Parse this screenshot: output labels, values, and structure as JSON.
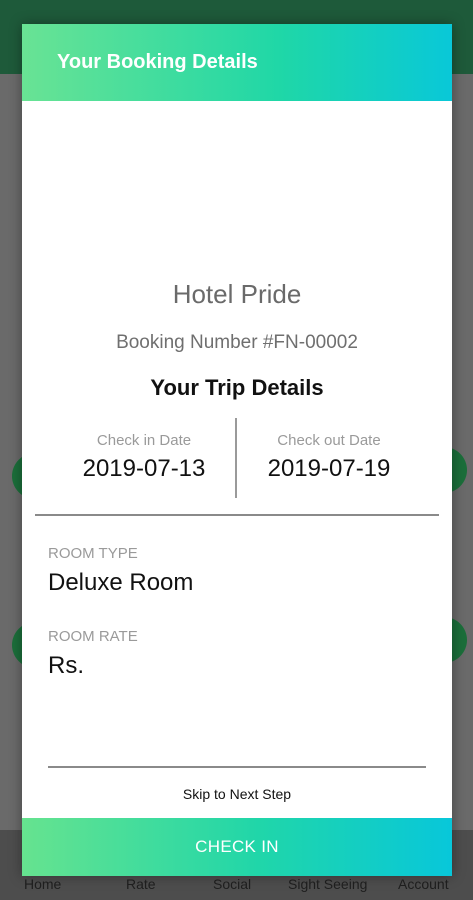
{
  "dialog": {
    "title": "Your Booking Details",
    "hotel_name": "Hotel Pride",
    "booking_number": "Booking Number #FN-00002",
    "trip_title": "Your Trip Details",
    "check_in_label": "Check in Date",
    "check_in_value": "2019-07-13",
    "check_out_label": "Check out Date",
    "check_out_value": "2019-07-19",
    "room_type_label": "ROOM TYPE",
    "room_type_value": "Deluxe Room",
    "room_rate_label": "ROOM RATE",
    "room_rate_value": "Rs.",
    "skip_label": "Skip to Next Step",
    "check_in_button": "CHECK IN"
  },
  "background_nav": {
    "items": [
      "Home",
      "Rate",
      "Social",
      "Sight Seeing",
      "Account"
    ]
  },
  "colors": {
    "gradient_start": "#69e394",
    "gradient_end": "#09c8d8",
    "background_primary": "#1e5a3a"
  }
}
